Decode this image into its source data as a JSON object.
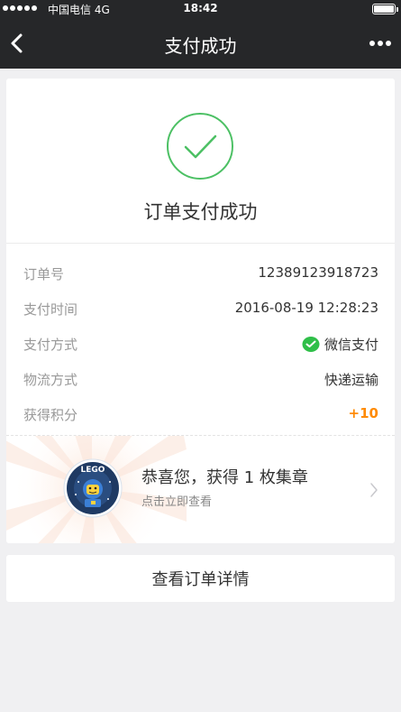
{
  "status_bar": {
    "carrier": "中国电信",
    "network": "4G",
    "time": "18:42"
  },
  "nav": {
    "title": "支付成功",
    "back_icon": "chevron-left-icon",
    "more_icon": "more-dots-icon"
  },
  "result": {
    "icon": "check-circle-icon",
    "title": "订单支付成功",
    "accent_color": "#4cc064"
  },
  "order_info": [
    {
      "label": "订单号",
      "value": "12389123918723"
    },
    {
      "label": "支付时间",
      "value": "2016-08-19 12:28:23"
    },
    {
      "label": "支付方式",
      "value": "微信支付",
      "icon": "wechat-pay-icon"
    },
    {
      "label": "物流方式",
      "value": "快递运输"
    },
    {
      "label": "获得积分",
      "value": "+10"
    }
  ],
  "points_color": "#ff8a00",
  "badge": {
    "title": "恭喜您，获得 1 枚集章",
    "subtitle": "点击立即查看",
    "badge_text": "LEGO",
    "icon": "lego-badge-icon"
  },
  "footer": {
    "detail_button_label": "查看订单详情"
  }
}
